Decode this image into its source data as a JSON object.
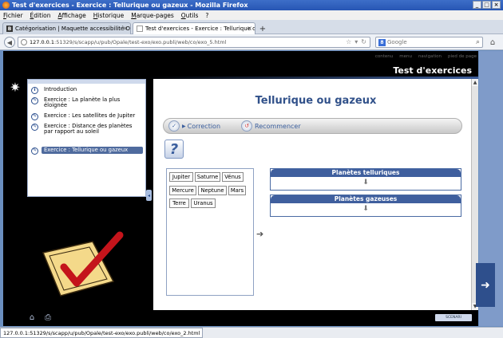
{
  "window": {
    "title": "Test d'exercices - Exercice : Tellurique ou gazeux - Mozilla Firefox",
    "controls": [
      "_",
      "□",
      "×"
    ]
  },
  "menu": [
    "Fichier",
    "Édition",
    "Affichage",
    "Historique",
    "Marque-pages",
    "Outils",
    "?"
  ],
  "tabs": [
    {
      "label": "Catégorisation | Maquette accessibilité O...",
      "favicon": "B"
    },
    {
      "label": "Test d'exercices - Exercice : Tellurique ou..."
    }
  ],
  "nav": {
    "url_host": "127.0.0.1",
    "url_rest": ":51329/s/scapp/u/pub/Opale/test-exo/exo.publi/web/co/exo_5.html",
    "search_placeholder": "Google"
  },
  "page": {
    "top_links": [
      "contenu",
      "menu",
      "navigation",
      "pied de page"
    ],
    "title": "Test d'exercices",
    "outline": [
      {
        "label": "Introduction",
        "icon": "info-icon",
        "active": false
      },
      {
        "label": "Exercice : La planète la plus éloignée",
        "icon": "exercise-icon",
        "active": false
      },
      {
        "label": "Exercice : Les satellites de Jupiter",
        "icon": "exercise-icon",
        "active": false
      },
      {
        "label": "Exercice : Distance des planètes par rapport au soleil",
        "icon": "exercise-icon",
        "active": false
      },
      {
        "label": "Exercice : Tellurique ou gazeux",
        "icon": "exercise-icon",
        "active": true
      }
    ],
    "exercise": {
      "title": "Tellurique ou gazeux",
      "correction_label": "Correction",
      "restart_label": "Recommencer",
      "help_glyph": "?",
      "words": [
        "Jupiter",
        "Saturne",
        "Vénus",
        "Mercure",
        "Neptune",
        "Mars",
        "Terre",
        "Uranus"
      ],
      "categories": [
        "Planètes telluriques",
        "Planètes gazeuses"
      ]
    },
    "badge": "SCENARI"
  },
  "status": {
    "url": "127.0.0.1:51329/s/scapp/u/pub/Opale/test-exo/exo.publi/web/co/exo_2.html"
  }
}
